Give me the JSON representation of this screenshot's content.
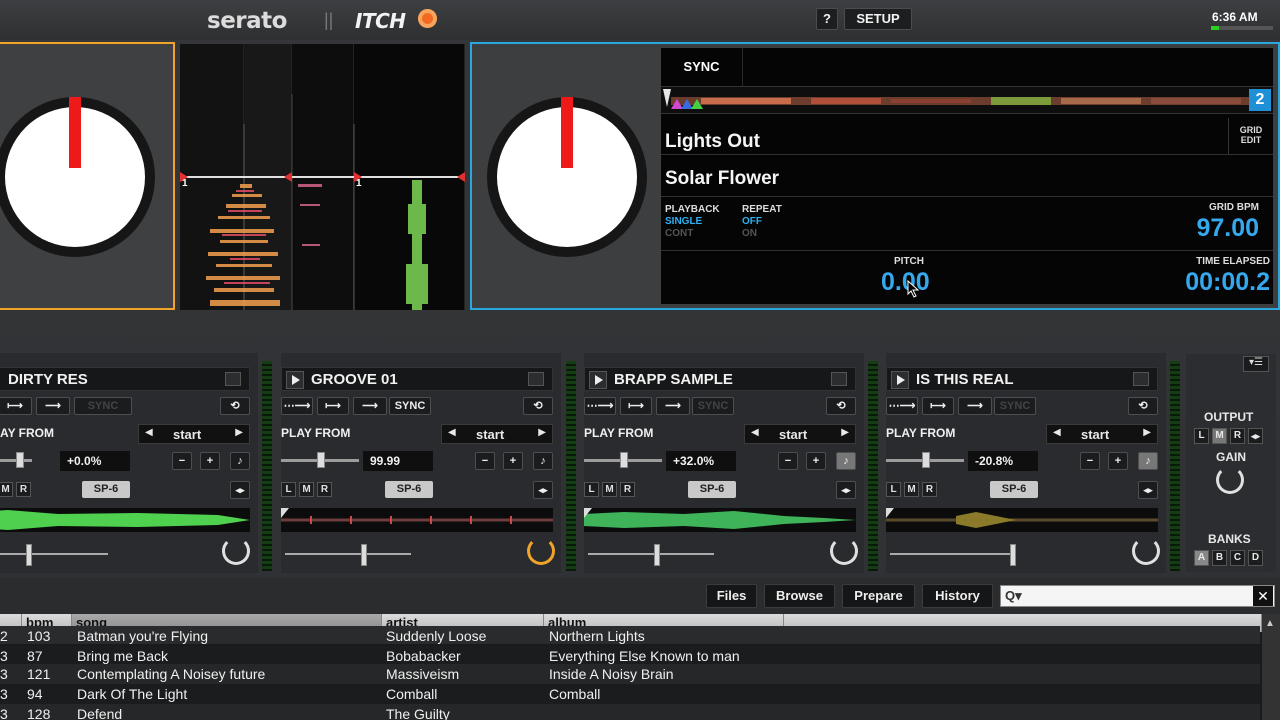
{
  "topbar": {
    "logo_serato": "serato",
    "logo_itch": "ITCH",
    "help_label": "?",
    "setup_label": "SETUP",
    "clock": "6:36 AM"
  },
  "deck2": {
    "sync_label": "SYNC",
    "deck_number": "2",
    "title": "Lights Out",
    "artist": "Solar Flower",
    "grid_edit": "GRID EDIT",
    "playback_label": "PLAYBACK",
    "playback_single": "SINGLE",
    "playback_cont": "CONT",
    "repeat_label": "REPEAT",
    "repeat_off": "OFF",
    "repeat_on": "ON",
    "grid_bpm_label": "GRID BPM",
    "grid_bpm": "97.00",
    "pitch_label": "PITCH",
    "pitch": "0.00",
    "time_label": "TIME ELAPSED",
    "time": "00:00.2"
  },
  "waveform_markers": [
    "1",
    "1"
  ],
  "sample_slots": [
    {
      "title": "DIRTY RES",
      "sync": "SYNC",
      "play_from": "AY FROM",
      "start": "start",
      "pitch": "+0.0%",
      "l": "M",
      "r": "R",
      "sp": "SP-6"
    },
    {
      "title": "GROOVE 01",
      "sync": "SYNC",
      "play_from": "PLAY FROM",
      "start": "start",
      "pitch": "99.99",
      "l": "L",
      "m": "M",
      "r": "R",
      "sp": "SP-6"
    },
    {
      "title": "BRAPP SAMPLE",
      "sync": "SYNC",
      "play_from": "PLAY FROM",
      "start": "start",
      "pitch": "+32.0%",
      "l": "L",
      "m": "M",
      "r": "R",
      "sp": "SP-6"
    },
    {
      "title": "IS THIS REAL",
      "sync": "SYNC",
      "play_from": "PLAY FROM",
      "start": "start",
      "pitch": "-20.8%",
      "l": "L",
      "m": "M",
      "r": "R",
      "sp": "SP-6"
    }
  ],
  "right_panel": {
    "output": "OUTPUT",
    "out_l": "L",
    "out_m": "M",
    "out_r": "R",
    "gain": "GAIN",
    "banks": "BANKS",
    "bank_a": "A",
    "bank_b": "B",
    "bank_c": "C",
    "bank_d": "D"
  },
  "library": {
    "tabs": [
      "Files",
      "Browse",
      "Prepare",
      "History"
    ],
    "search_icon_label": "Q▾",
    "close": "✕",
    "columns": [
      "bpm",
      "song",
      "artist",
      "album"
    ],
    "rows": [
      {
        "num": "2",
        "bpm": "103",
        "song": "Batman you're Flying",
        "artist": "Suddenly Loose",
        "album": "Northern Lights"
      },
      {
        "num": "3",
        "bpm": "87",
        "song": "Bring me Back",
        "artist": "Bobabacker",
        "album": "Everything Else Known to man"
      },
      {
        "num": "3",
        "bpm": "121",
        "song": "Contemplating A Noisey future",
        "artist": "Massiveism",
        "album": "Inside A Noisy Brain"
      },
      {
        "num": "3",
        "bpm": "94",
        "song": "Dark Of The Light",
        "artist": "Comball",
        "album": "Comball"
      },
      {
        "num": "3",
        "bpm": "128",
        "song": "Defend",
        "artist": "The Guilty",
        "album": ""
      }
    ]
  }
}
